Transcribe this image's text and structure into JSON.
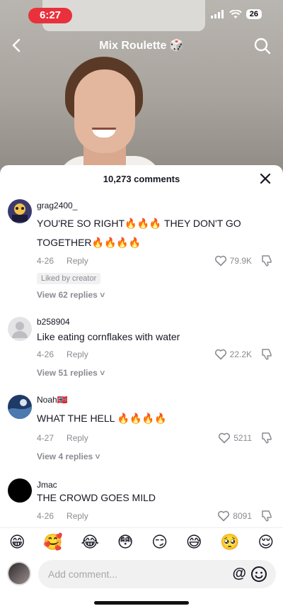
{
  "status": {
    "time": "6:27",
    "battery": "26"
  },
  "nav": {
    "title": "Mix Roulette 🎲"
  },
  "sheet": {
    "comment_count": "10,273 comments"
  },
  "comments": [
    {
      "username": "grag2400_",
      "text_line1": "YOU'RE SO RIGHT🔥🔥🔥 THEY DON'T GO",
      "text_line2": "TOGETHER🔥🔥🔥🔥",
      "date": "4-26",
      "reply": "Reply",
      "likes": "79.9K",
      "badge": "Liked by creator",
      "view_replies": "View 62 replies"
    },
    {
      "username": "b258904",
      "text_line1": "Like eating cornflakes with water",
      "date": "4-26",
      "reply": "Reply",
      "likes": "22.2K",
      "view_replies": "View 51 replies"
    },
    {
      "username": "Noah🇳🇴",
      "text_line1": "WHAT THE HELL 🔥🔥🔥🔥",
      "date": "4-27",
      "reply": "Reply",
      "likes": "5211",
      "view_replies": "View 4 replies"
    },
    {
      "username": "Jmac",
      "text_line1": "THE CROWD GOES MILD",
      "date": "4-26",
      "reply": "Reply",
      "likes": "8091"
    }
  ],
  "emojis": [
    "😁",
    "🥰",
    "😂",
    "😳",
    "😏",
    "😅",
    "🥺",
    "😌"
  ],
  "input": {
    "placeholder": "Add comment...",
    "at_label": "@"
  }
}
